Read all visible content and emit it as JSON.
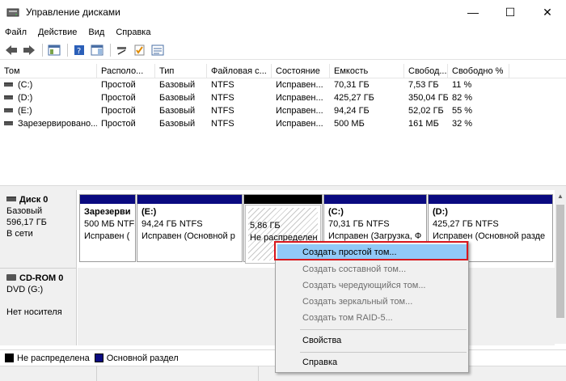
{
  "window": {
    "title": "Управление дисками",
    "minimize": "—",
    "maximize": "☐",
    "close": "✕"
  },
  "menu": [
    "Файл",
    "Действие",
    "Вид",
    "Справка"
  ],
  "table": {
    "columns": [
      "Том",
      "Располо...",
      "Тип",
      "Файловая с...",
      "Состояние",
      "Емкость",
      "Свобод...",
      "Свободно %"
    ],
    "rows": [
      [
        "(C:)",
        "Простой",
        "Базовый",
        "NTFS",
        "Исправен...",
        "70,31 ГБ",
        "7,53 ГБ",
        "11 %"
      ],
      [
        "(D:)",
        "Простой",
        "Базовый",
        "NTFS",
        "Исправен...",
        "425,27 ГБ",
        "350,04 ГБ",
        "82 %"
      ],
      [
        "(E:)",
        "Простой",
        "Базовый",
        "NTFS",
        "Исправен...",
        "94,24 ГБ",
        "52,02 ГБ",
        "55 %"
      ],
      [
        "Зарезервировано...",
        "Простой",
        "Базовый",
        "NTFS",
        "Исправен...",
        "500 МБ",
        "161 МБ",
        "32 %"
      ]
    ]
  },
  "disks": {
    "disk0": {
      "name": "Диск 0",
      "type": "Базовый",
      "size": "596,17 ГБ",
      "status": "В сети"
    },
    "cdrom0": {
      "name": "CD-ROM 0",
      "type": "DVD (G:)",
      "status": "Нет носителя"
    }
  },
  "partitions": [
    {
      "name": "Зарезерви",
      "line1": "500 МБ NTFS",
      "line2": "Исправен ("
    },
    {
      "name": "(E:)",
      "line1": "94,24 ГБ NTFS",
      "line2": "Исправен (Основной р"
    },
    {
      "name": "",
      "line1": "5,86 ГБ",
      "line2": "Не распределена"
    },
    {
      "name": "(C:)",
      "line1": "70,31 ГБ NTFS",
      "line2": "Исправен (Загрузка, Ф"
    },
    {
      "name": "(D:)",
      "line1": "425,27 ГБ NTFS",
      "line2": "Исправен (Основной разде"
    }
  ],
  "legend": {
    "unallocated": "Не распределена",
    "primary": "Основной раздел"
  },
  "context_menu": [
    {
      "label": "Создать простой том...",
      "enabled": true
    },
    {
      "label": "Создать составной том...",
      "enabled": false
    },
    {
      "label": "Создать чередующийся том...",
      "enabled": false
    },
    {
      "label": "Создать зеркальный том...",
      "enabled": false
    },
    {
      "label": "Создать том RAID-5...",
      "enabled": false
    },
    {
      "label": "Свойства",
      "enabled": true
    },
    {
      "label": "Справка",
      "enabled": true
    }
  ],
  "colors": {
    "primary_partition": "#0a0a80",
    "unallocated": "#000000",
    "highlight": "#91c9f7",
    "annotation_outline": "#d9171d"
  }
}
